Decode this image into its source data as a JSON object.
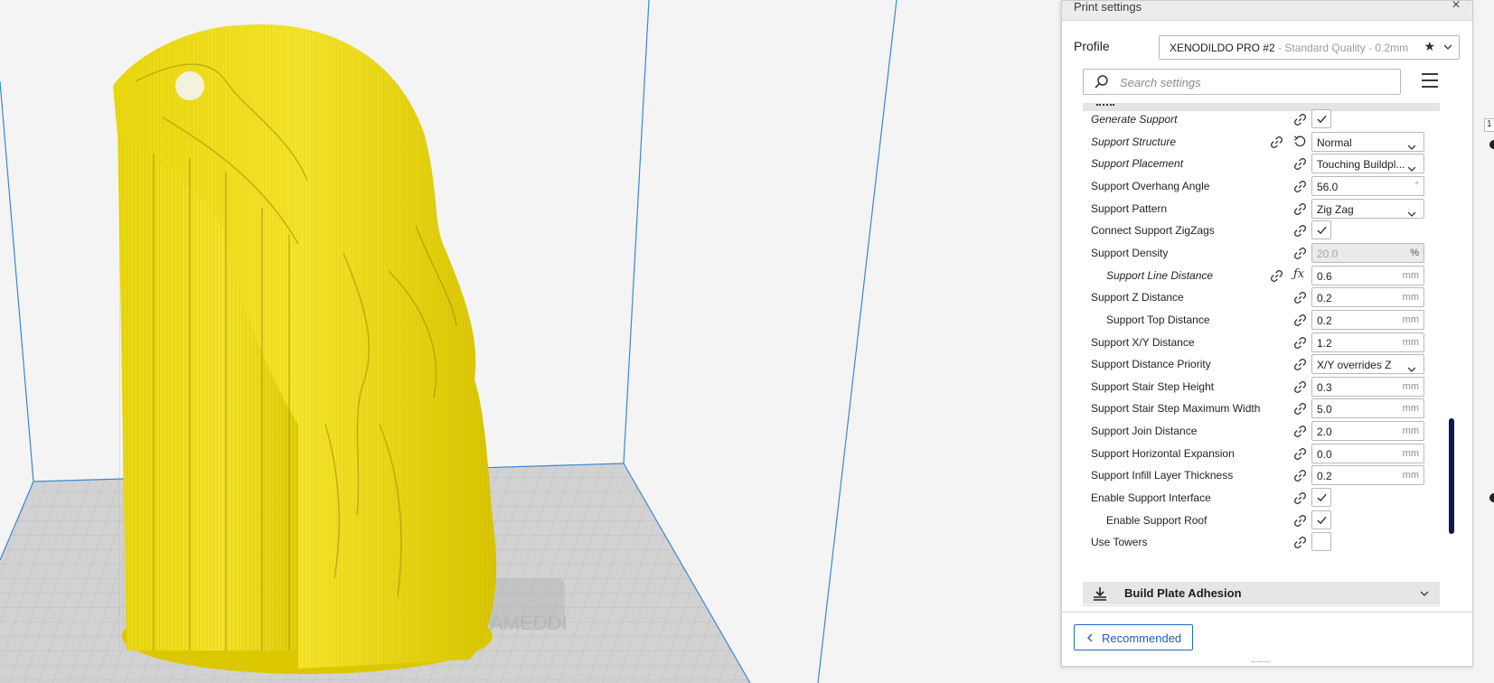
{
  "panel": {
    "title": "Print settings",
    "close_label": "×",
    "profile_label": "Profile",
    "profile_name": "XENODILDO PRO #2",
    "profile_detail": " - Standard Quality - 0.2mm",
    "favorite_icon": "star-icon",
    "search_placeholder": "Search settings",
    "recommended_label": "Recommended"
  },
  "settings": [
    {
      "label": "Generate Support",
      "control": "checkbox",
      "checked": true,
      "italic": true
    },
    {
      "label": "Support Structure",
      "control": "combo",
      "value": "Normal",
      "italic": true,
      "reset": true
    },
    {
      "label": "Support Placement",
      "control": "combo",
      "value": "Touching Buildpl...",
      "italic": true
    },
    {
      "label": "Support Overhang Angle",
      "control": "number",
      "value": "56.0",
      "unit": "°"
    },
    {
      "label": "Support Pattern",
      "control": "combo",
      "value": "Zig Zag"
    },
    {
      "label": "Connect Support ZigZags",
      "control": "checkbox",
      "checked": true
    },
    {
      "label": "Support Density",
      "control": "number",
      "value": "20.0",
      "unit": "%",
      "disabled": true
    },
    {
      "label": "Support Line Distance",
      "control": "number",
      "value": "0.6",
      "unit": "mm",
      "italic": true,
      "indent": true,
      "fx": true
    },
    {
      "label": "Support Z Distance",
      "control": "number",
      "value": "0.2",
      "unit": "mm"
    },
    {
      "label": "Support Top Distance",
      "control": "number",
      "value": "0.2",
      "unit": "mm",
      "indent": true
    },
    {
      "label": "Support X/Y Distance",
      "control": "number",
      "value": "1.2",
      "unit": "mm"
    },
    {
      "label": "Support Distance Priority",
      "control": "combo",
      "value": "X/Y overrides Z"
    },
    {
      "label": "Support Stair Step Height",
      "control": "number",
      "value": "0.3",
      "unit": "mm"
    },
    {
      "label": "Support Stair Step Maximum Width",
      "control": "number",
      "value": "5.0",
      "unit": "mm"
    },
    {
      "label": "Support Join Distance",
      "control": "number",
      "value": "2.0",
      "unit": "mm"
    },
    {
      "label": "Support Horizontal Expansion",
      "control": "number",
      "value": "0.0",
      "unit": "mm"
    },
    {
      "label": "Support Infill Layer Thickness",
      "control": "number",
      "value": "0.2",
      "unit": "mm"
    },
    {
      "label": "Enable Support Interface",
      "control": "checkbox",
      "checked": true
    },
    {
      "label": "Enable Support Roof",
      "control": "checkbox",
      "checked": true,
      "indent": true
    },
    {
      "label": "Use Towers",
      "control": "checkbox",
      "checked": false
    }
  ],
  "adhesion_category": {
    "label": "Build Plate Adhesion",
    "icon": "adhesion-icon"
  },
  "right_edge": {
    "field_value": "1"
  },
  "colors": {
    "model": "#f0e020",
    "model_shadow": "#b9a400",
    "accent": "#1f69c4",
    "scrollbar": "#0c1a4a"
  }
}
